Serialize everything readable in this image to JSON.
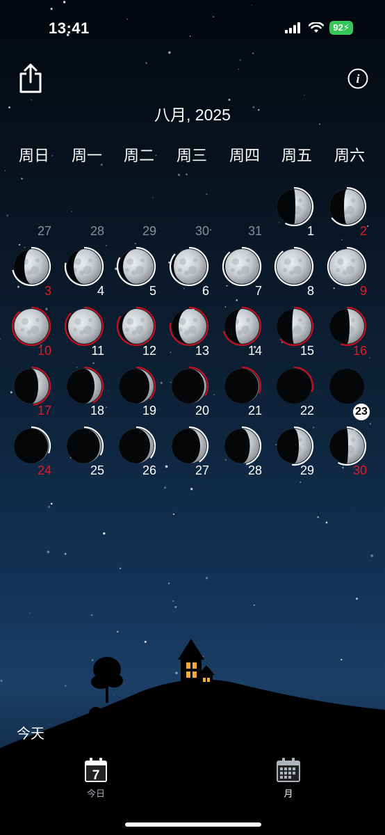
{
  "status": {
    "time": "13:41",
    "battery": "92"
  },
  "header": {
    "month_title": "八月, 2025"
  },
  "weekdays": [
    "周日",
    "周一",
    "周二",
    "周三",
    "周四",
    "周五",
    "周六"
  ],
  "calendar": {
    "cells": [
      {
        "day": "27",
        "style": "grey",
        "phase": null,
        "ring": null
      },
      {
        "day": "28",
        "style": "grey",
        "phase": null,
        "ring": null
      },
      {
        "day": "29",
        "style": "grey",
        "phase": null,
        "ring": null
      },
      {
        "day": "30",
        "style": "grey",
        "phase": null,
        "ring": null
      },
      {
        "day": "31",
        "style": "grey",
        "phase": null,
        "ring": null
      },
      {
        "day": "1",
        "style": "white",
        "phase": 0.46,
        "ring": "white"
      },
      {
        "day": "2",
        "style": "red",
        "phase": 0.58,
        "ring": "white"
      },
      {
        "day": "3",
        "style": "red",
        "phase": 0.7,
        "ring": "white"
      },
      {
        "day": "4",
        "style": "white",
        "phase": 0.8,
        "ring": "white"
      },
      {
        "day": "5",
        "style": "white",
        "phase": 0.88,
        "ring": "white"
      },
      {
        "day": "6",
        "style": "white",
        "phase": 0.94,
        "ring": "white"
      },
      {
        "day": "7",
        "style": "white",
        "phase": 0.98,
        "ring": "white"
      },
      {
        "day": "8",
        "style": "white",
        "phase": 1.0,
        "ring": "white"
      },
      {
        "day": "9",
        "style": "red",
        "phase": 1.0,
        "ring": "white"
      },
      {
        "day": "10",
        "style": "red",
        "phase": 0.99,
        "ring": "red"
      },
      {
        "day": "11",
        "style": "white",
        "phase": 0.96,
        "ring": "red"
      },
      {
        "day": "12",
        "style": "white",
        "phase": 0.9,
        "ring": "red"
      },
      {
        "day": "13",
        "style": "white",
        "phase": 0.8,
        "ring": "red"
      },
      {
        "day": "14",
        "style": "white",
        "phase": 0.68,
        "ring": "red"
      },
      {
        "day": "15",
        "style": "white",
        "phase": 0.55,
        "ring": "red"
      },
      {
        "day": "16",
        "style": "red",
        "phase": 0.42,
        "ring": "red"
      },
      {
        "day": "17",
        "style": "red",
        "phase": 0.3,
        "ring": "red"
      },
      {
        "day": "18",
        "style": "white",
        "phase": 0.2,
        "ring": "red"
      },
      {
        "day": "19",
        "style": "white",
        "phase": 0.12,
        "ring": "red"
      },
      {
        "day": "20",
        "style": "white",
        "phase": 0.06,
        "ring": "red"
      },
      {
        "day": "21",
        "style": "white",
        "phase": 0.02,
        "ring": "red"
      },
      {
        "day": "22",
        "style": "white",
        "phase": 0.0,
        "ring": "red"
      },
      {
        "day": "23",
        "style": "today",
        "phase": 0.0,
        "ring": null
      },
      {
        "day": "24",
        "style": "red",
        "phase": 0.02,
        "ring": "white"
      },
      {
        "day": "25",
        "style": "white",
        "phase": 0.05,
        "ring": "white"
      },
      {
        "day": "26",
        "style": "white",
        "phase": 0.1,
        "ring": "white"
      },
      {
        "day": "27",
        "style": "white",
        "phase": 0.18,
        "ring": "white"
      },
      {
        "day": "28",
        "style": "white",
        "phase": 0.27,
        "ring": "white"
      },
      {
        "day": "29",
        "style": "white",
        "phase": 0.36,
        "ring": "white"
      },
      {
        "day": "30",
        "style": "red",
        "phase": 0.46,
        "ring": "white"
      }
    ]
  },
  "footer": {
    "today_label": "今天"
  },
  "tabs": [
    {
      "label": "今日",
      "icon": "calendar-day-icon",
      "day": "7"
    },
    {
      "label": "月",
      "icon": "calendar-month-icon"
    }
  ],
  "colors": {
    "weekend_red": "#e01a24",
    "ring_red": "#c8101c",
    "ring_white": "#ffffff"
  }
}
